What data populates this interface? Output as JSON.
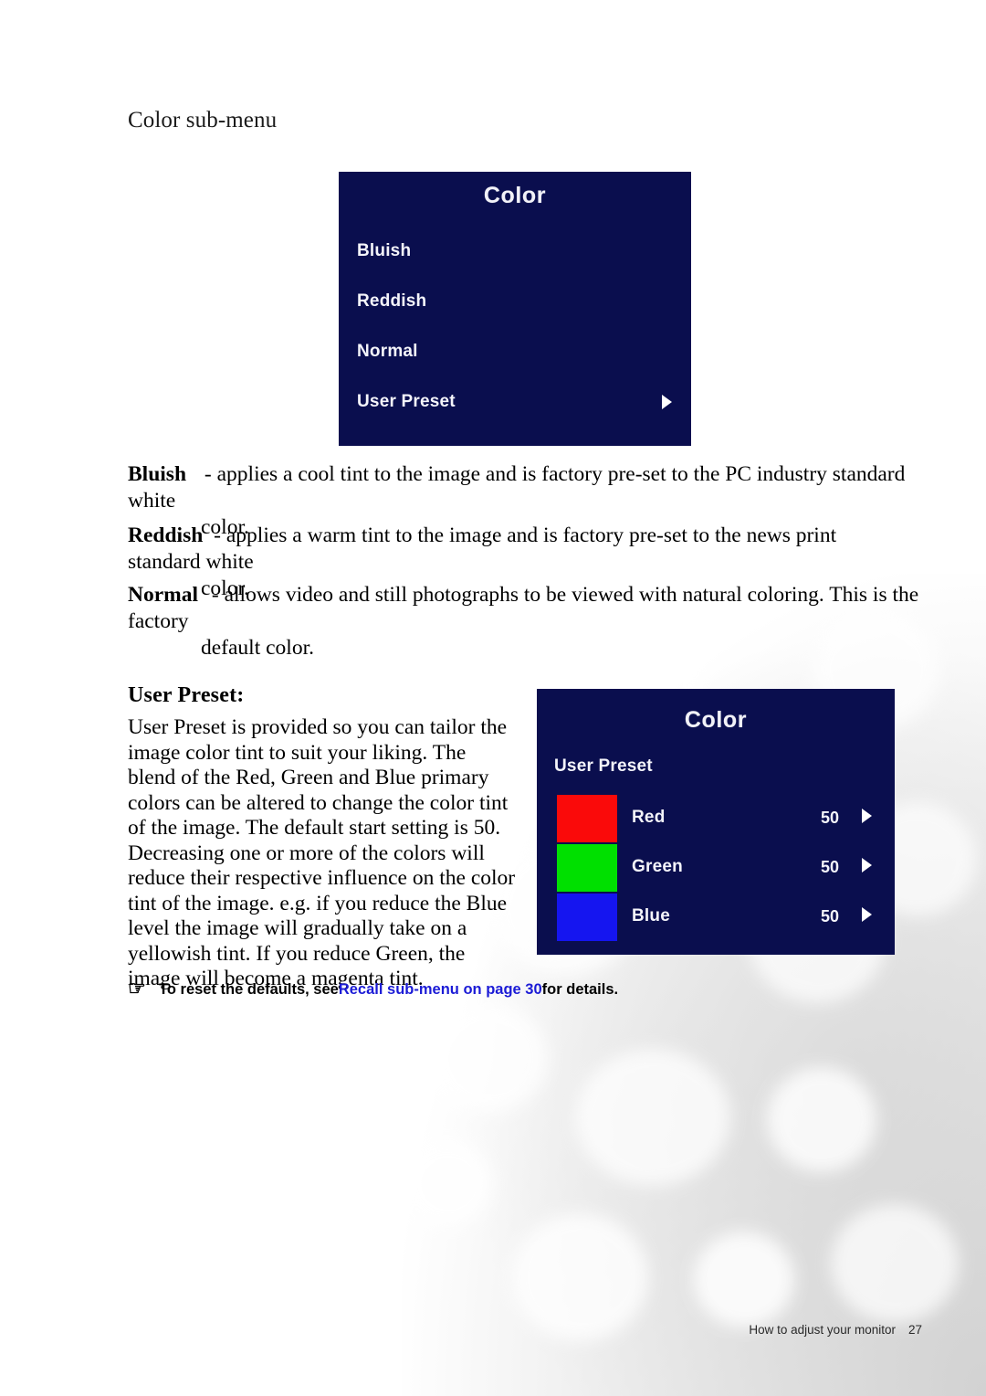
{
  "page": {
    "section_heading": "Color sub-menu"
  },
  "osd_color_menu": {
    "title": "Color",
    "items": [
      {
        "label": "Bluish",
        "has_arrow": false
      },
      {
        "label": "Reddish",
        "has_arrow": false
      },
      {
        "label": "Normal",
        "has_arrow": false
      },
      {
        "label": "User Preset",
        "has_arrow": true
      }
    ],
    "background_color": "#0a0e4e",
    "text_color": "#f4f4fa"
  },
  "definitions": [
    {
      "term": "Bluish",
      "description": "- applies a cool tint to the image and is factory pre-set to the PC industry standard white",
      "continuation": "color."
    },
    {
      "term": "Reddish",
      "description": "- applies a warm tint to the image and is factory pre-set to the news print standard white",
      "continuation": "color."
    },
    {
      "term": "Normal",
      "description": "- allows video and still photographs to be viewed with natural coloring. This is the factory",
      "continuation": "default color."
    }
  ],
  "user_preset": {
    "heading": "User Preset:",
    "body": "User Preset is provided so you can tailor the image color tint to suit your liking. The blend of the Red, Green and Blue primary colors can be altered to change the color tint of the image. The default start setting is 50. Decreasing one or more of the colors will reduce their respective influence on the color tint of the image. e.g. if you reduce the Blue level the image will gradually take on a yellowish tint. If you reduce Green, the image will become a magenta tint."
  },
  "osd_user_preset": {
    "title": "Color",
    "subtitle": "User Preset",
    "background_color": "#0a0e4e",
    "rows": [
      {
        "label": "Red",
        "value": "50",
        "swatch_color": "#fa0a0a",
        "has_arrow": true
      },
      {
        "label": "Green",
        "value": "50",
        "swatch_color": "#00e000",
        "has_arrow": true
      },
      {
        "label": "Blue",
        "value": "50",
        "swatch_color": "#1515f0",
        "has_arrow": true
      }
    ]
  },
  "note": {
    "icon": "pointing-hand-icon",
    "icon_glyph": "☞",
    "text_before": "To reset the defaults, see ",
    "link_text": "Recall sub-menu on page 30",
    "text_after": " for details.",
    "link_color": "#1b1bd6"
  },
  "footer": {
    "chapter": "How to adjust your monitor",
    "page_number": "27"
  }
}
